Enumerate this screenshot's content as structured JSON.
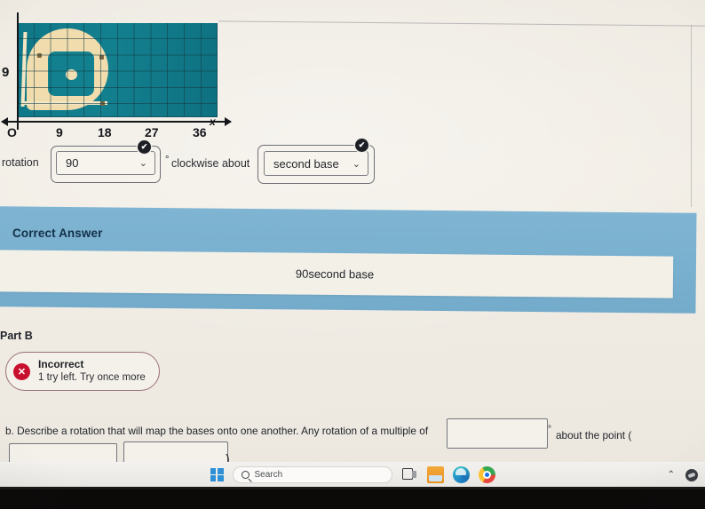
{
  "graph": {
    "x_axis_label": "x",
    "origin_label": "O",
    "y_tick_label": "9",
    "x_ticks": [
      "9",
      "18",
      "27",
      "36"
    ]
  },
  "part_a": {
    "rotation_label": "rotation",
    "degree_symbol": "°",
    "clockwise_label": "clockwise about",
    "angle_select": {
      "value": "90",
      "chevron": "⌄"
    },
    "point_select": {
      "value": "second base",
      "chevron": "⌄"
    },
    "check_badge": "✔"
  },
  "correct_answer": {
    "heading": "Correct Answer",
    "value": "90second base"
  },
  "part_b": {
    "heading": "Part B",
    "alert": {
      "icon": "✕",
      "title": "Incorrect",
      "subtitle": "1 try left. Try once more"
    },
    "question_text": "b. Describe a rotation that will map the bases onto one another. Any rotation of a multiple of",
    "degree_symbol": "°",
    "tail_text": "about the point (",
    "closing_paren": ")",
    "inputs": {
      "multiple_value": "",
      "x_value": "",
      "y_value": ""
    }
  },
  "taskbar": {
    "start_name": "start-button",
    "search_placeholder": "Search",
    "task_view": "Task view",
    "file_explorer": "File Explorer",
    "edge": "Microsoft Edge",
    "chrome": "Google Chrome",
    "show_hidden": "⌃"
  },
  "colors": {
    "band_blue": "#79b0cf",
    "field_green": "#11798a",
    "infield_tan": "#f0dcac",
    "incorrect_red": "#c8102e",
    "paper": "#efebe3"
  }
}
